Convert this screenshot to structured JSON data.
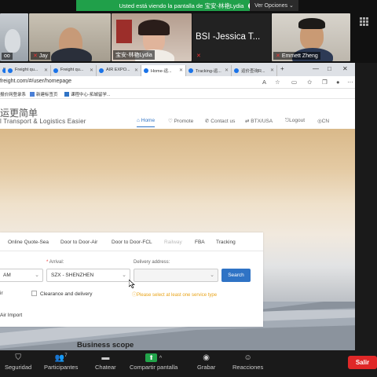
{
  "zoom": {
    "sharing_banner": "Usted está viendo la pantalla de 宝安-林艳Lydia",
    "view_options": "Ver Opciones",
    "participants": [
      {
        "name": "oo"
      },
      {
        "name": "Jay"
      },
      {
        "name": "宝安-林艳Lydia"
      },
      {
        "name": "Jessica T...",
        "big_label": "BSI -Jessica T..."
      },
      {
        "name": "Emmett Zheng"
      }
    ],
    "toolbar": {
      "security": "Seguridad",
      "participants": "Participantes",
      "participants_count": "7",
      "chat": "Chatear",
      "share": "Compartir pantalla",
      "record": "Grabar",
      "reactions": "Reacciones",
      "leave": "Salir"
    }
  },
  "browser": {
    "tabs": [
      {
        "label": "Freight qu..."
      },
      {
        "label": "Freight qu..."
      },
      {
        "label": "AIR EXPO..."
      },
      {
        "label": "Home-运..."
      },
      {
        "label": "Tracking-运..."
      },
      {
        "label": "运价查询R..."
      }
    ],
    "url": "freight.com/#/user/homepage",
    "bookmarks": [
      "报价网登录系",
      "新建标签页",
      "课程中心-拓城留学..."
    ],
    "window_controls": [
      "—",
      "□",
      "✕"
    ]
  },
  "site": {
    "logo_cn": "运更简单",
    "logo_en": "l Transport & Logistics Easier",
    "nav": [
      {
        "label": "Home",
        "icon": "home-icon"
      },
      {
        "label": "Promote",
        "icon": "promote-icon"
      },
      {
        "label": "Contact us",
        "icon": "phone-icon"
      },
      {
        "label": "BTX/USA",
        "icon": "transfer-icon"
      },
      {
        "label": "Logout",
        "icon": "logout-icon"
      },
      {
        "label": "CN",
        "icon": "globe-icon"
      }
    ],
    "search_panel": {
      "tabs": [
        "Online Quote-Sea",
        "Door to Door-Air",
        "Door to Door-FCL",
        "Railway",
        "FBA",
        "Tracking"
      ],
      "arrival_label": "Arrival:",
      "delivery_label": "Delivery address:",
      "departure_value": "AM",
      "arrival_value": "SZX - SHENZHEN",
      "delivery_value": "",
      "search_button": "Search",
      "check_air": "ir",
      "check_clearance": "Clearance and delivery",
      "warning": "Please select at least one service type",
      "air_import": "Air Import"
    },
    "business_scope": "Business scope"
  },
  "colors": {
    "zoom_green": "#20a04a",
    "leave_red": "#e02828",
    "brand_blue": "#2f73c5",
    "warning_orange": "#e8a317"
  }
}
